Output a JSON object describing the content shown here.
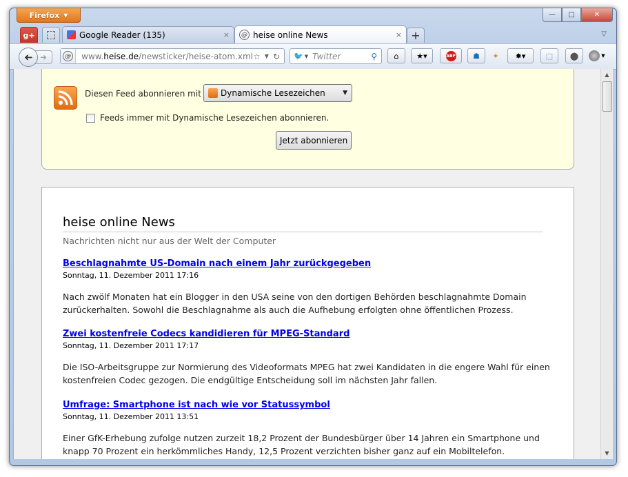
{
  "browser": {
    "menu_button": "Firefox",
    "window_controls": {
      "minimize": "—",
      "maximize": "□",
      "close": "✕"
    }
  },
  "tabs": [
    {
      "title": "Google Reader (135)",
      "active": false,
      "close": "×"
    },
    {
      "title": "heise online News",
      "active": true,
      "close": "×"
    }
  ],
  "new_tab_label": "+",
  "navbar": {
    "url_prefix": "www.",
    "url_domain": "heise.de",
    "url_path": "/newsticker/heise-atom.xml",
    "search_placeholder": "Twitter"
  },
  "subscribe": {
    "label": "Diesen Feed abonnieren mit",
    "reader_selected": "Dynamische Lesezeichen",
    "always_checkbox_label": "Feeds immer mit Dynamische Lesezeichen abonnieren.",
    "always_checked": false,
    "button_label": "Jetzt abonnieren"
  },
  "feed": {
    "title": "heise online News",
    "subtitle": "Nachrichten nicht nur aus der Welt der Computer",
    "entries": [
      {
        "title": "Beschlagnahmte US-Domain nach einem Jahr zurückgegeben",
        "date": "Sonntag, 11. Dezember 2011 17:16",
        "summary": "Nach zwölf Monaten hat ein Blogger in den USA seine von den dortigen Behörden beschlagnahmte Domain zurückerhalten. Sowohl die Beschlagnahme als auch die Aufhebung erfolgten ohne öffentlichen Prozess."
      },
      {
        "title": "Zwei kostenfreie Codecs kandidieren für MPEG-Standard",
        "date": "Sonntag, 11. Dezember 2011 17:17",
        "summary": "Die ISO-Arbeitsgruppe zur Normierung des Videoformats MPEG hat zwei Kandidaten in die engere Wahl für einen kostenfreien Codec gezogen. Die endgültige Entscheidung soll im nächsten Jahr fallen."
      },
      {
        "title": "Umfrage: Smartphone ist nach wie vor Statussymbol",
        "date": "Sonntag, 11. Dezember 2011 13:51",
        "summary": "Einer GfK-Erhebung zufolge nutzen zurzeit 18,2 Prozent der Bundesbürger über 14 Jahren ein Smartphone und knapp 70 Prozent ein herkömmliches Handy, 12,5 Prozent verzichten bisher ganz auf ein Mobiltelefon."
      }
    ]
  },
  "colors": {
    "link": "#0000ee",
    "subscribe_bg": "#ffffe1",
    "firefox_button": "#e8862f"
  }
}
